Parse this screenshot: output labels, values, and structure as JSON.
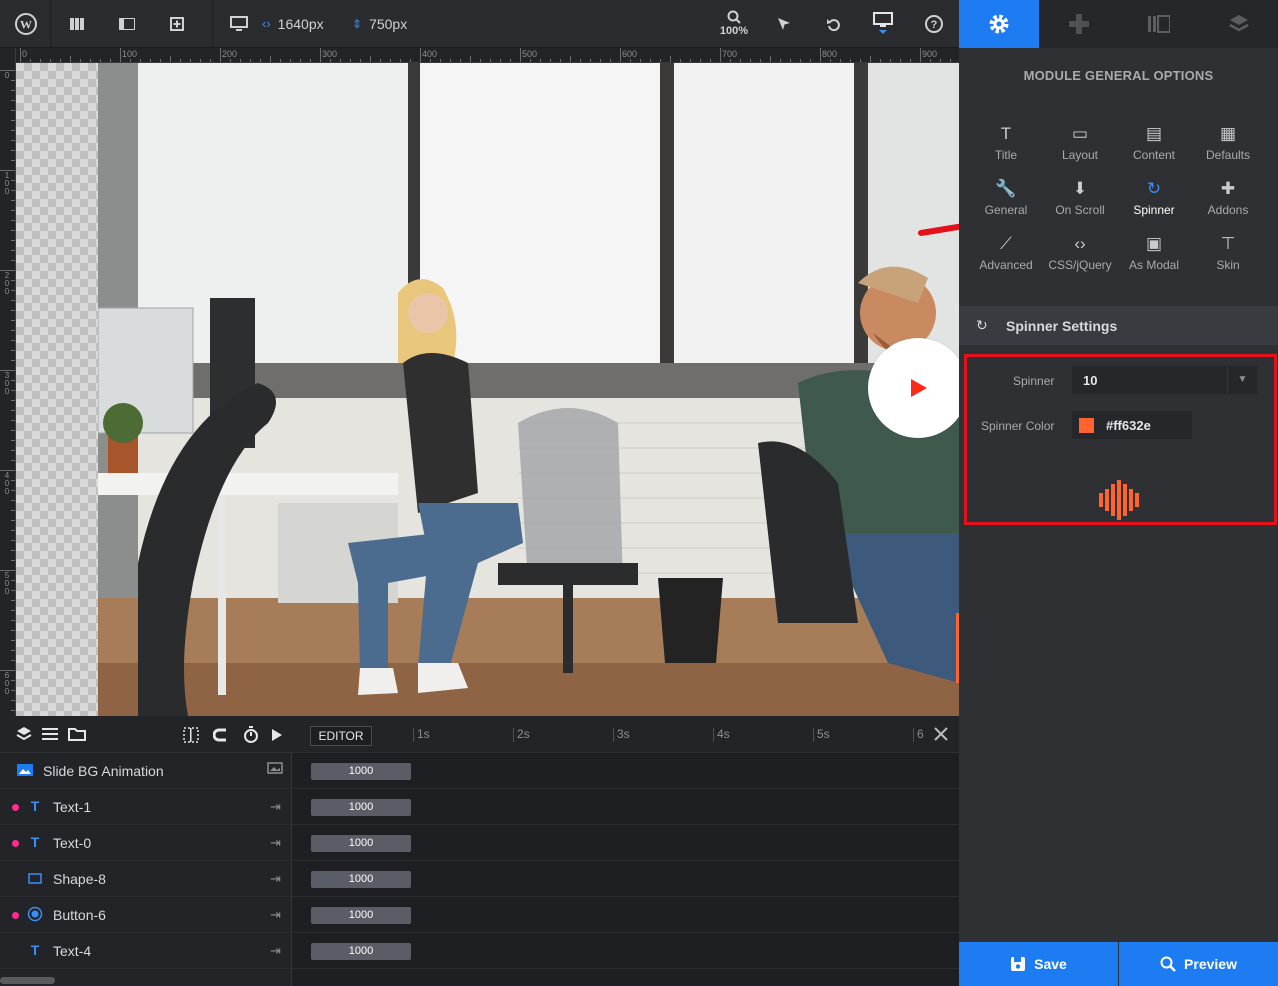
{
  "toolbar": {
    "width_value": "1640px",
    "height_value": "750px",
    "zoom": "100%"
  },
  "ruler": {
    "top_labels": [
      "0",
      "100",
      "200",
      "300",
      "400",
      "500",
      "600",
      "700",
      "800",
      "900"
    ],
    "left_labels": [
      "0",
      "100",
      "200",
      "300",
      "400",
      "500",
      "600"
    ]
  },
  "timeline": {
    "editor_label": "EDITOR",
    "seconds": [
      "1s",
      "2s",
      "3s",
      "4s",
      "5s",
      "6"
    ],
    "rows": [
      {
        "name": "Slide BG Animation",
        "duration": "1000"
      },
      {
        "name": "Text-1",
        "duration": "1000"
      },
      {
        "name": "Text-0",
        "duration": "1000"
      },
      {
        "name": "Shape-8",
        "duration": "1000"
      },
      {
        "name": "Button-6",
        "duration": "1000"
      },
      {
        "name": "Text-4",
        "duration": "1000"
      }
    ]
  },
  "panel": {
    "title": "MODULE GENERAL OPTIONS",
    "options": [
      {
        "label": "Title",
        "icon": "T"
      },
      {
        "label": "Layout",
        "icon": "▭"
      },
      {
        "label": "Content",
        "icon": "▤"
      },
      {
        "label": "Defaults",
        "icon": "▦"
      },
      {
        "label": "General",
        "icon": "🔧"
      },
      {
        "label": "On Scroll",
        "icon": "⬇"
      },
      {
        "label": "Spinner",
        "icon": "↻"
      },
      {
        "label": "Addons",
        "icon": "✚"
      },
      {
        "label": "Advanced",
        "icon": "⟋"
      },
      {
        "label": "CSS/jQuery",
        "icon": "‹›"
      },
      {
        "label": "As Modal",
        "icon": "▣"
      },
      {
        "label": "Skin",
        "icon": "⊤"
      }
    ],
    "section_title": "Spinner Settings",
    "spinner_label": "Spinner",
    "spinner_value": "10",
    "color_label": "Spinner Color",
    "color_value": "#ff632e",
    "save_label": "Save",
    "preview_label": "Preview"
  },
  "colors": {
    "accent": "#1d7cf2",
    "spinner": "#ff632e",
    "highlight": "#e4111b"
  }
}
